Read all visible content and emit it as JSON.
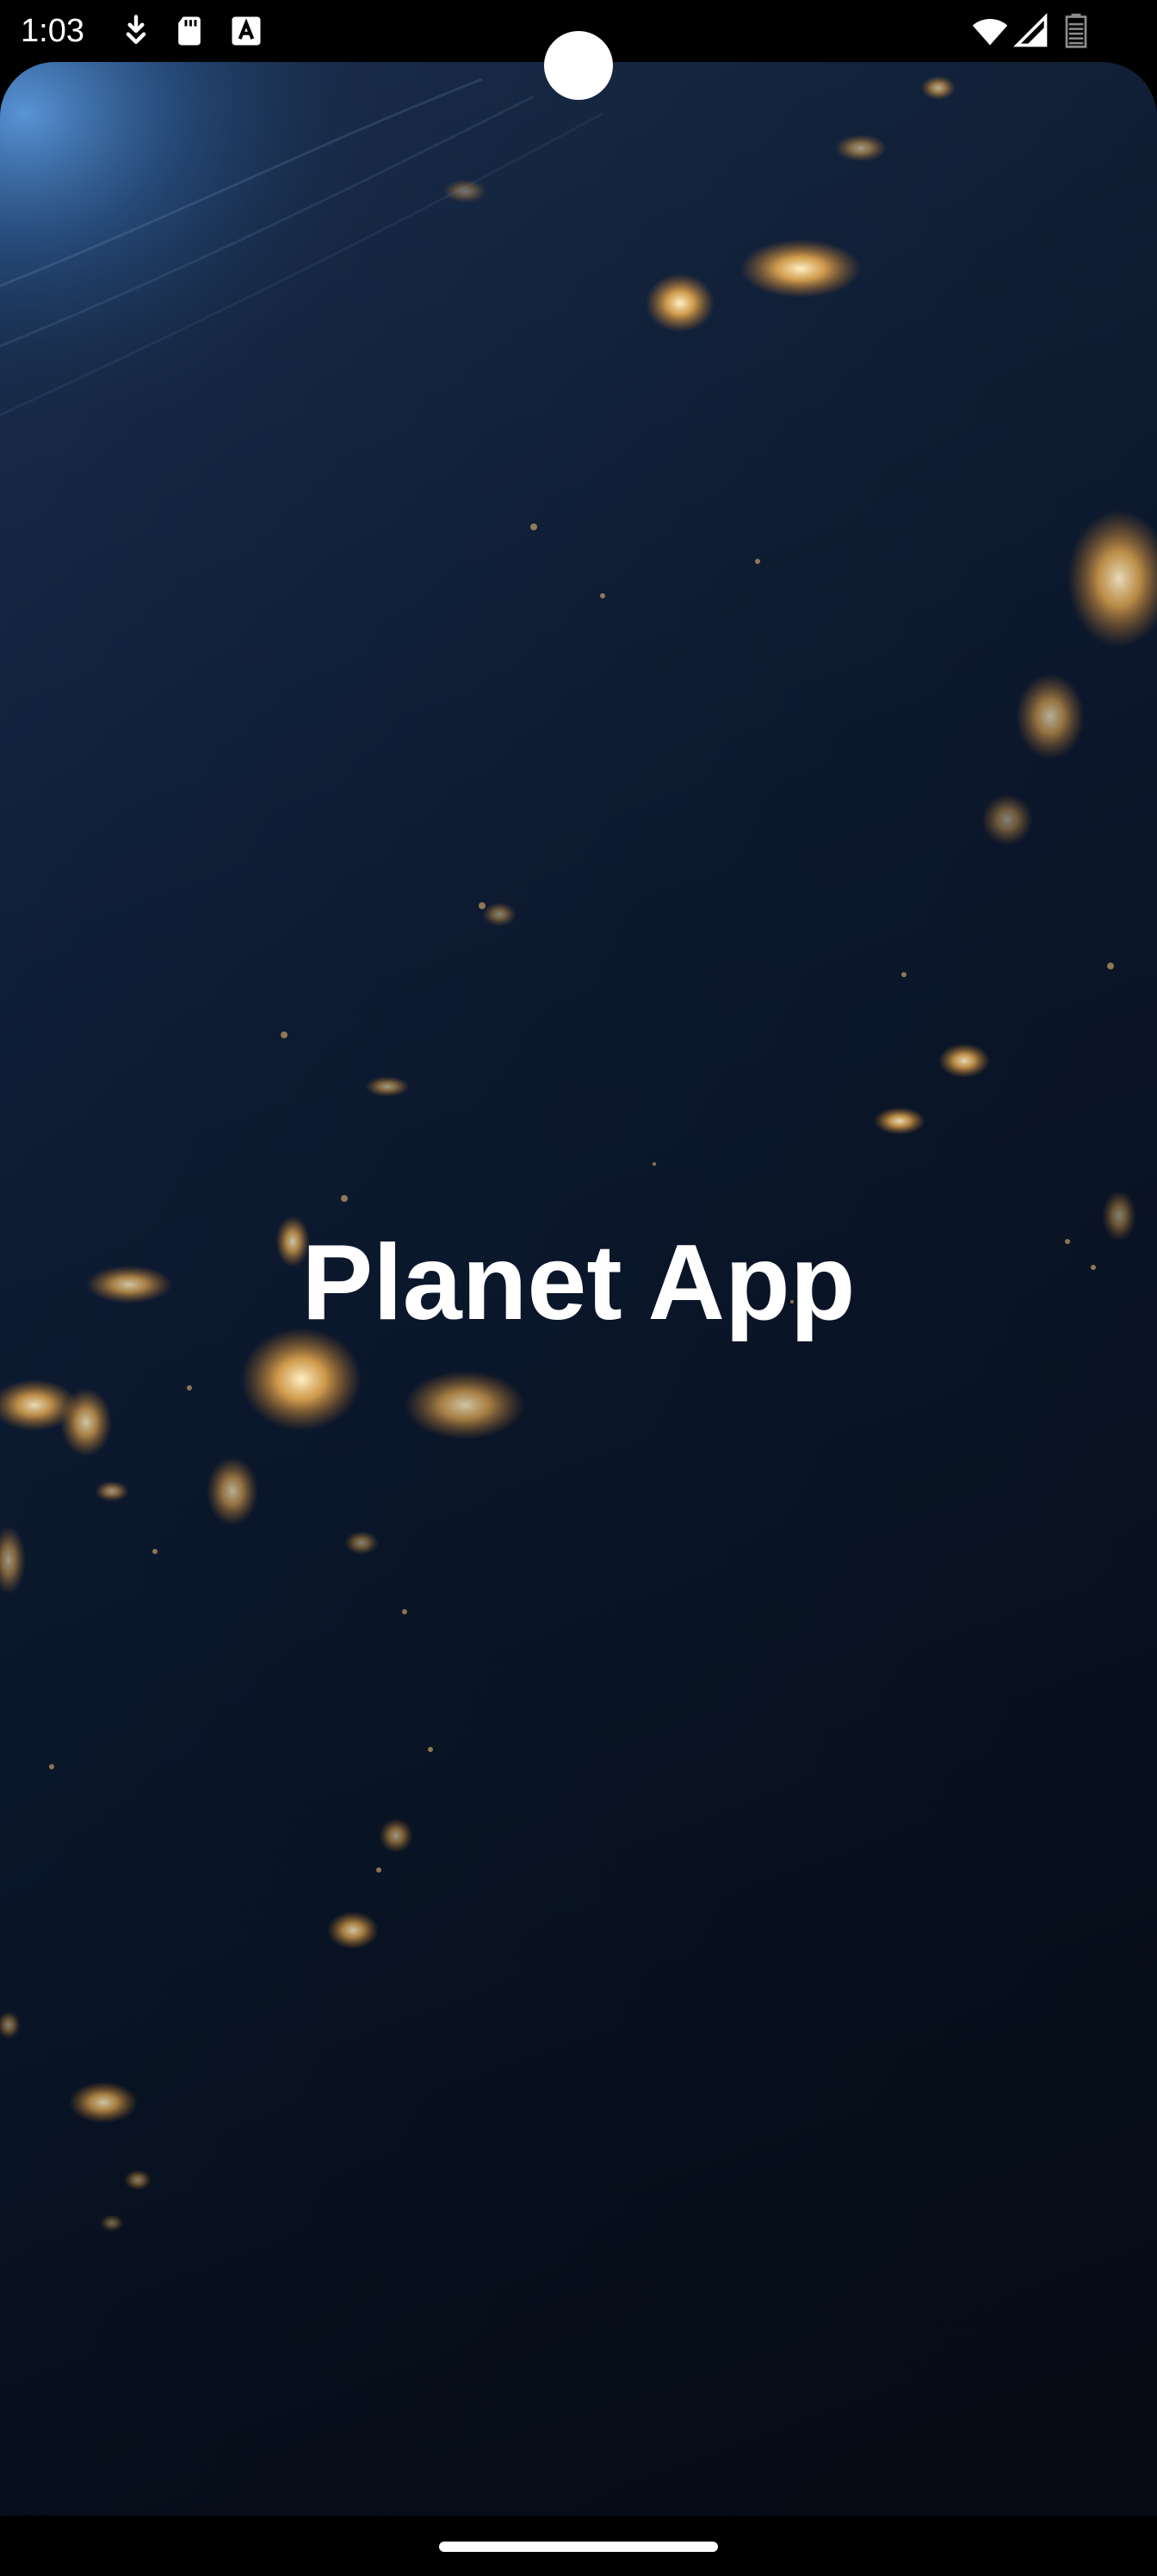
{
  "status_bar": {
    "time": "1:03",
    "left_icons": [
      "download-icon",
      "sd-card-icon",
      "text-a-icon"
    ],
    "right_icons": [
      "wifi-icon",
      "cellular-signal-icon",
      "battery-icon"
    ]
  },
  "screen": {
    "title": "Planet App",
    "background": "earth-at-night-image"
  },
  "colors": {
    "title_text": "#ffffff",
    "background_dark": "#0b1a30",
    "city_lights": "#f5b85a"
  }
}
